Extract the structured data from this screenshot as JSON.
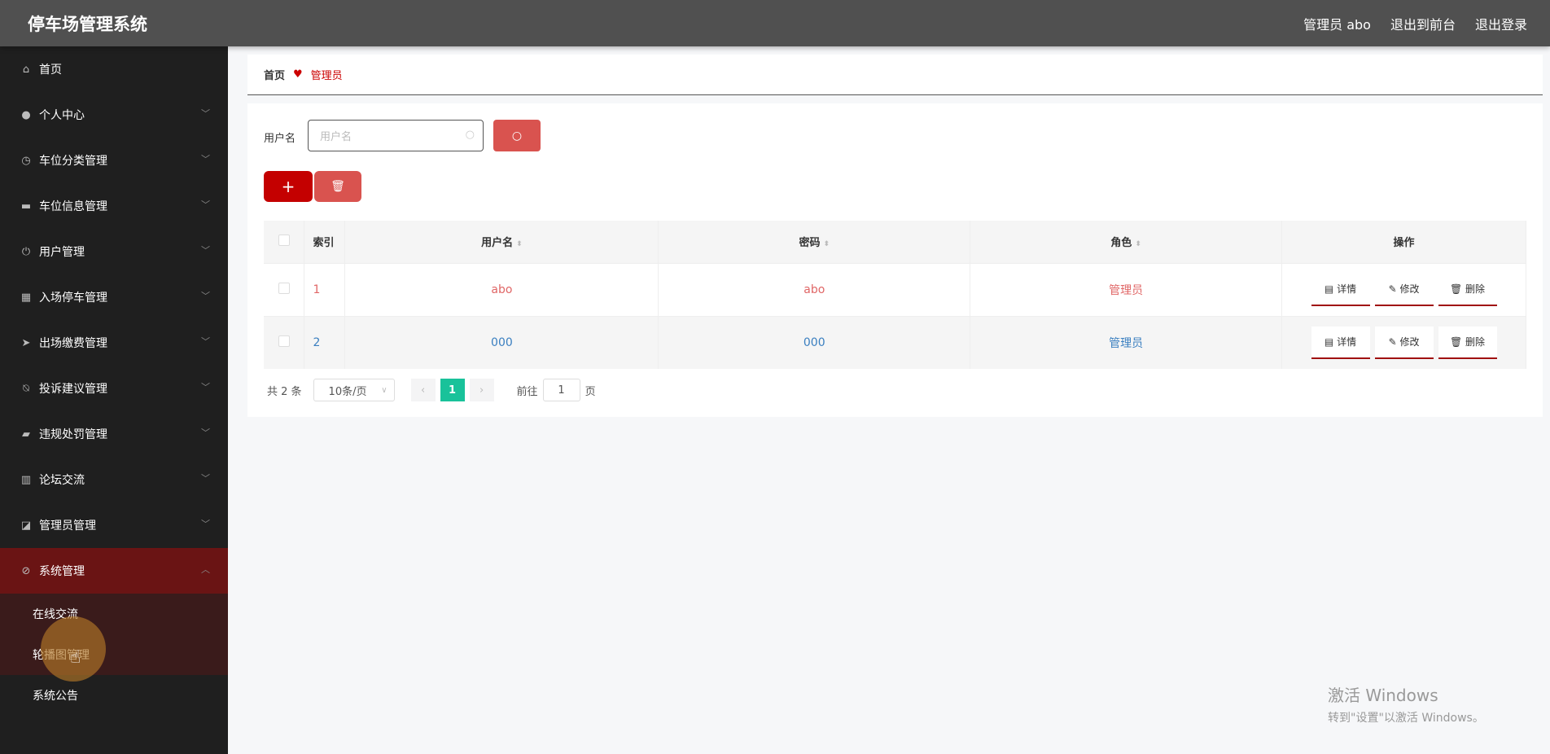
{
  "header": {
    "title": "停车场管理系统",
    "user": "管理员 abo",
    "front": "退出到前台",
    "logout": "退出登录"
  },
  "sidebar": {
    "items": [
      {
        "label": "首页",
        "icon": "home-icon"
      },
      {
        "label": "个人中心",
        "icon": "user-icon"
      },
      {
        "label": "车位分类管理",
        "icon": "clock-icon"
      },
      {
        "label": "车位信息管理",
        "icon": "ticket-icon"
      },
      {
        "label": "用户管理",
        "icon": "power-icon"
      },
      {
        "label": "入场停车管理",
        "icon": "grid-icon"
      },
      {
        "label": "出场缴费管理",
        "icon": "send-icon"
      },
      {
        "label": "投诉建议管理",
        "icon": "bell-off-icon"
      },
      {
        "label": "违规处罚管理",
        "icon": "inbox-icon"
      },
      {
        "label": "论坛交流",
        "icon": "bar-chart-icon"
      },
      {
        "label": "管理员管理",
        "icon": "line-chart-icon"
      },
      {
        "label": "系统管理",
        "icon": "compass-icon"
      }
    ],
    "submenu": [
      "在线交流",
      "轮播图管理",
      "系统公告"
    ]
  },
  "breadcrumb": {
    "home": "首页",
    "current": "管理员"
  },
  "search": {
    "label": "用户名",
    "placeholder": "用户名"
  },
  "table": {
    "headers": [
      "索引",
      "用户名",
      "密码",
      "角色",
      "操作"
    ],
    "rows": [
      {
        "index": "1",
        "username": "abo",
        "password": "abo",
        "role": "管理员"
      },
      {
        "index": "2",
        "username": "000",
        "password": "000",
        "role": "管理员"
      }
    ],
    "actions": {
      "detail": "详情",
      "edit": "修改",
      "delete": "删除"
    }
  },
  "pagination": {
    "total": "共 2 条",
    "page_size": "10条/页",
    "current": "1",
    "goto_label": "前往",
    "goto_value": "1",
    "page_suffix": "页"
  },
  "watermark": {
    "line1": "激活 Windows",
    "line2": "转到\"设置\"以激活 Windows。"
  },
  "colors": {
    "header": "#505050",
    "sidebar": "#1f1f1f",
    "active": "#6a1414",
    "accent": "#c40000",
    "page_active": "#19c29a"
  }
}
